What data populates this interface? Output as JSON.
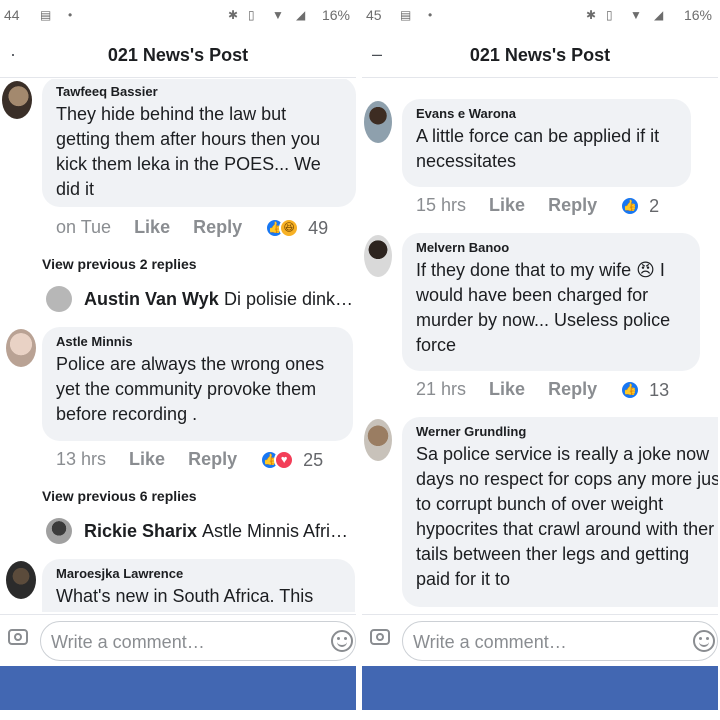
{
  "colors": {
    "accent": "#4267b2",
    "like_blue": "#1877f2",
    "bubble_bg": "#f0f2f5",
    "meta_text": "#8a8d91"
  },
  "left": {
    "status": {
      "time": "44",
      "battery": "16%"
    },
    "header": {
      "back_icon": "back-arrow-icon",
      "title": "021 News's Post"
    },
    "comments": [
      {
        "author": "Tawfeeq Bassier",
        "text": "They hide behind the law but getting them after hours then you kick them leka in the POES... We did it",
        "time": "on Tue",
        "like": "Like",
        "reply": "Reply",
        "reactions": [
          "like",
          "haha"
        ],
        "reaction_count": "49"
      },
      {
        "author": "Astle Minnis",
        "text": "Police are always the wrong ones yet the community provoke them before recording .",
        "time": "13 hrs",
        "like": "Like",
        "reply": "Reply",
        "reactions": [
          "like",
          "love"
        ],
        "reaction_count": "25"
      },
      {
        "author": "Maroesjka Lawrence",
        "text": "What's new in South Africa. This"
      }
    ],
    "view_previous": [
      "View previous 2 replies",
      "View previous 6 replies"
    ],
    "reply_previews": [
      {
        "name": "Austin Van Wyk",
        "text": "Di polisie dink…"
      },
      {
        "name": "Rickie Sharix",
        "text": "Astle Minnis Afri…"
      }
    ],
    "composer": {
      "placeholder": "Write a comment…"
    }
  },
  "right": {
    "status": {
      "time": "45",
      "battery": "16%"
    },
    "header": {
      "back_icon": "back-arrow-icon",
      "title": "021 News's Post"
    },
    "comments": [
      {
        "author": "Evans e Warona",
        "text": "A little force can be applied if it necessitates",
        "time": "15 hrs",
        "like": "Like",
        "reply": "Reply",
        "reactions": [
          "like"
        ],
        "reaction_count": "2"
      },
      {
        "author": "Melvern Banoo",
        "text": "If they done that to my wife 😠 I would have been charged for murder by now... Useless police force",
        "time": "21 hrs",
        "like": "Like",
        "reply": "Reply",
        "reactions": [
          "like"
        ],
        "reaction_count": "13"
      },
      {
        "author": "Werner Grundling",
        "text": "Sa police service is really a joke now days no respect for cops any more just to corrupt  bunch of over weight hypocrites that crawl around with ther tails between ther legs and getting paid for it to"
      }
    ],
    "composer": {
      "placeholder": "Write a comment…"
    }
  }
}
